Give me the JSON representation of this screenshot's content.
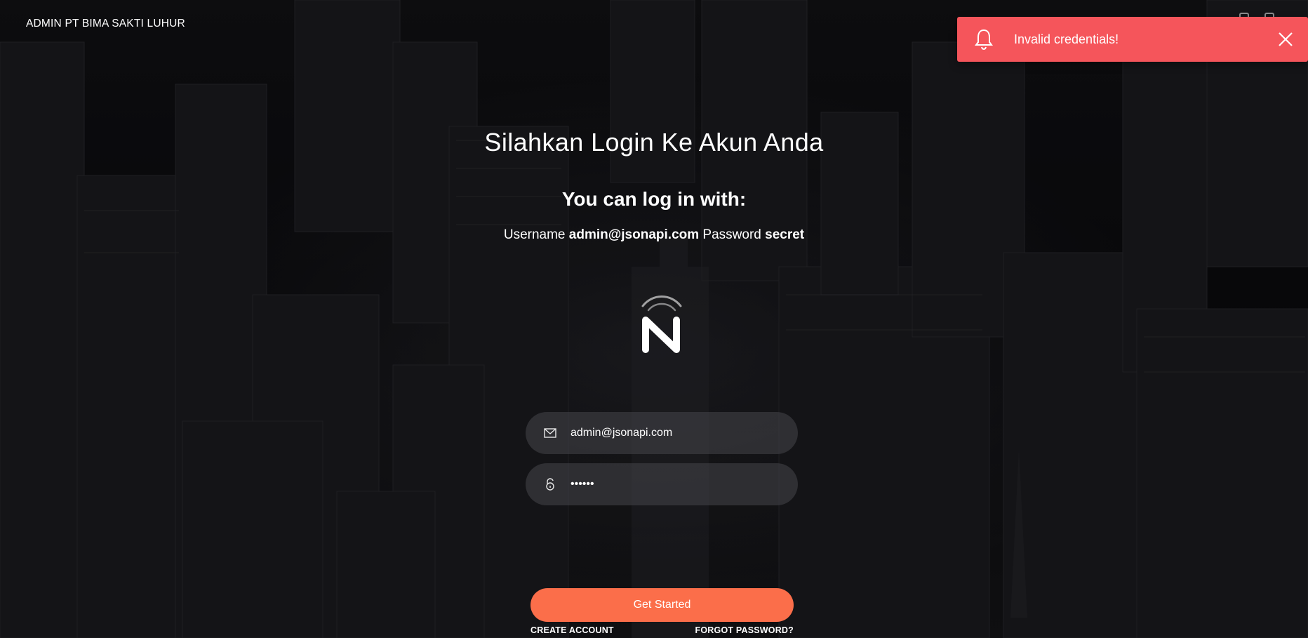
{
  "brand": {
    "name": "ADMIN PT BIMA SAKTI LUHUR"
  },
  "toast": {
    "message": "Invalid credentials!",
    "color": "#f5555b"
  },
  "login": {
    "title": "Silahkan Login Ke Akun Anda",
    "subtitle": "You can log in with:",
    "creds": {
      "username_label": "Username",
      "username_value": "admin@jsonapi.com",
      "password_label": "Password",
      "password_value": "secret"
    },
    "email_field": {
      "value": "admin@jsonapi.com",
      "icon": "envelope-icon"
    },
    "password_field": {
      "value": "secret",
      "icon": "unlock-icon"
    },
    "submit_label": "Get Started",
    "accent_color": "#fb6e4a",
    "links": {
      "create_account": "CREATE ACCOUNT",
      "forgot_password": "FORGOT PASSWORD?"
    }
  }
}
